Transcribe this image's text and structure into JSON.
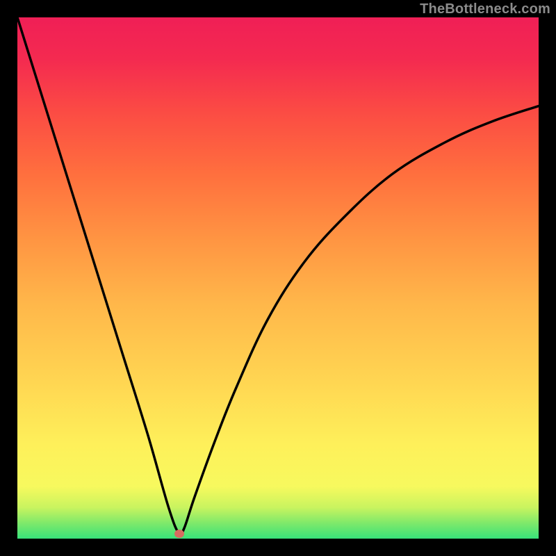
{
  "watermark": {
    "text": "TheBottleneck.com"
  },
  "colors": {
    "frame": "#000000",
    "curve_stroke": "#000000",
    "marker_fill": "#d76b60",
    "watermark_text": "#8b8b8b",
    "gradient_stops": [
      "#38e27a",
      "#7fe96a",
      "#c9f45f",
      "#f7f95e",
      "#fef05a",
      "#ffd652",
      "#ffb74a",
      "#ff9342",
      "#ff6f3e",
      "#fb4b44",
      "#f42a50",
      "#f01f56"
    ]
  },
  "chart_data": {
    "type": "line",
    "title": "",
    "xlabel": "",
    "ylabel": "",
    "xlim": [
      0,
      1
    ],
    "ylim": [
      0,
      1
    ],
    "note": "Background is a vertical gradient (green at bottom → red at top) acting as a heat scale. A single black curve descends steeply from near (0,1) to a minimum near x≈0.31 then rises asymptotically toward ~0.83. A small red/orange marker sits at the curve's minimum. No axis ticks, labels, legend, or gridlines are visible.",
    "series": [
      {
        "name": "bottleneck-curve",
        "x": [
          0.0,
          0.05,
          0.1,
          0.15,
          0.2,
          0.25,
          0.29,
          0.31,
          0.32,
          0.34,
          0.38,
          0.42,
          0.48,
          0.55,
          0.63,
          0.72,
          0.82,
          0.91,
          1.0
        ],
        "y": [
          1.0,
          0.84,
          0.68,
          0.52,
          0.36,
          0.2,
          0.06,
          0.01,
          0.02,
          0.08,
          0.19,
          0.29,
          0.42,
          0.53,
          0.62,
          0.7,
          0.76,
          0.8,
          0.83
        ]
      }
    ],
    "marker": {
      "x": 0.31,
      "y": 0.01
    }
  }
}
